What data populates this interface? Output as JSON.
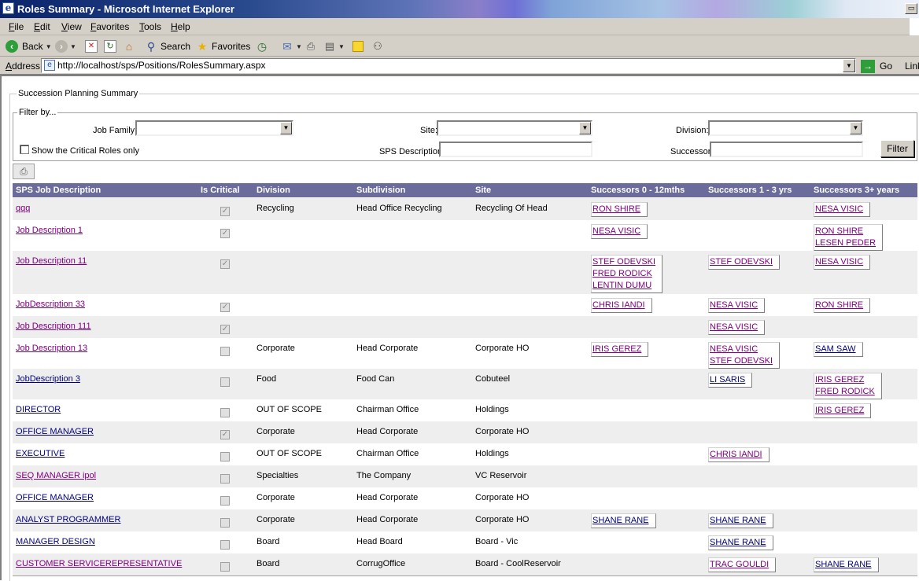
{
  "window": {
    "title": "Roles Summary - Microsoft Internet Explorer",
    "icon": "ie-page-icon"
  },
  "menu": [
    "File",
    "Edit",
    "View",
    "Favorites",
    "Tools",
    "Help"
  ],
  "toolbar": {
    "back_label": "Back",
    "search_label": "Search",
    "favorites_label": "Favorites"
  },
  "address": {
    "label": "Address",
    "url": "http://localhost/sps/Positions/RolesSummary.aspx",
    "go_label": "Go",
    "links_label": "Link"
  },
  "page": {
    "summary_legend": "Succession Planning Summary",
    "filter_legend": "Filter by...",
    "job_family_label": "Job Family:",
    "job_family_value": "",
    "site_label": "Site:",
    "site_value": "",
    "division_label": "Division:",
    "division_value": "",
    "critical_only_label": "Show the Critical Roles only",
    "critical_only_checked": false,
    "sps_description_label": "SPS Description:",
    "sps_description_value": "",
    "successor_label": "Successor:",
    "successor_value": "",
    "filter_button": "Filter"
  },
  "grid": {
    "columns": [
      "SPS Job Description",
      "Is Critical",
      "Division",
      "Subdivision",
      "Site",
      "Successors 0 - 12mths",
      "Successors 1 - 3 yrs",
      "Successors 3+ years"
    ],
    "rows": [
      {
        "job": "qqq",
        "visited": true,
        "critical": true,
        "division": "Recycling",
        "subdivision": "Head Office Recycling",
        "site": "Recycling Of  Head",
        "s0": [
          "RON SHIRE"
        ],
        "s1": [],
        "s3": [
          "NESA VISIC"
        ]
      },
      {
        "job": "Job Description 1",
        "visited": true,
        "critical": true,
        "division": "",
        "subdivision": "",
        "site": "",
        "s0": [
          "NESA VISIC"
        ],
        "s1": [],
        "s3": [
          "RON SHIRE",
          "LESEN PEDER"
        ]
      },
      {
        "job": "Job Description 11",
        "visited": true,
        "critical": true,
        "division": "",
        "subdivision": "",
        "site": "",
        "s0": [
          "STEF ODEVSKI",
          "FRED RODICK",
          "LENTIN DUMU"
        ],
        "s1": [
          "STEF ODEVSKI"
        ],
        "s3": [
          "NESA VISIC"
        ]
      },
      {
        "job": "JobDescription 33",
        "visited": true,
        "critical": true,
        "division": "",
        "subdivision": "",
        "site": "",
        "s0": [
          "CHRIS IANDI"
        ],
        "s1": [
          "NESA VISIC"
        ],
        "s3": [
          "RON SHIRE"
        ]
      },
      {
        "job": "Job Description 111",
        "visited": true,
        "critical": true,
        "division": "",
        "subdivision": "",
        "site": "",
        "s0": [],
        "s1": [
          "NESA VISIC"
        ],
        "s3": []
      },
      {
        "job": "Job Description 13",
        "visited": true,
        "critical": false,
        "division": "Corporate",
        "subdivision": "Head Corporate",
        "site": "Corporate HO",
        "s0": [
          "IRIS GEREZ"
        ],
        "s1": [
          "NESA VISIC",
          "STEF ODEVSKI"
        ],
        "s3": [
          "SAM SAW"
        ]
      },
      {
        "job": "JobDescription 3",
        "visited": false,
        "critical": false,
        "division": "Food",
        "subdivision": "Food Can",
        "site": "Cobuteel",
        "s0": [],
        "s1": [
          "LI SARIS"
        ],
        "s3": [
          "IRIS GEREZ",
          "FRED RODICK"
        ]
      },
      {
        "job": "DIRECTOR",
        "visited": false,
        "critical": false,
        "division": "OUT OF SCOPE",
        "subdivision": "Chairman Office",
        "site": "Holdings",
        "s0": [],
        "s1": [],
        "s3": [
          "IRIS GEREZ"
        ]
      },
      {
        "job": "OFFICE MANAGER",
        "visited": false,
        "critical": true,
        "division": "Corporate",
        "subdivision": "Head Corporate",
        "site": "Corporate HO",
        "s0": [],
        "s1": [],
        "s3": []
      },
      {
        "job": "EXECUTIVE",
        "visited": false,
        "critical": false,
        "division": "OUT OF SCOPE",
        "subdivision": "Chairman Office",
        "site": "Holdings",
        "s0": [],
        "s1": [
          "CHRIS IANDI"
        ],
        "s3": []
      },
      {
        "job": "SEQ MANAGER ipol",
        "visited": true,
        "critical": false,
        "division": "Specialties",
        "subdivision": "The Company",
        "site": "VC Reservoir",
        "s0": [],
        "s1": [],
        "s3": []
      },
      {
        "job": "OFFICE MANAGER",
        "visited": false,
        "critical": false,
        "division": "Corporate",
        "subdivision": "Head Corporate",
        "site": "Corporate HO",
        "s0": [],
        "s1": [],
        "s3": []
      },
      {
        "job": "ANALYST PROGRAMMER",
        "visited": false,
        "critical": false,
        "division": "Corporate",
        "subdivision": "Head Corporate",
        "site": "Corporate HO",
        "s0": [
          "SHANE RANE"
        ],
        "s1": [
          "SHANE RANE"
        ],
        "s3": []
      },
      {
        "job": "MANAGER DESIGN",
        "visited": false,
        "critical": false,
        "division": "Board",
        "subdivision": "Head Board",
        "site": "Board - Vic",
        "s0": [],
        "s1": [
          "SHANE RANE"
        ],
        "s3": []
      },
      {
        "job": "CUSTOMER SERVICEREPRESENTATIVE",
        "visited": true,
        "critical": false,
        "division": "Board",
        "subdivision": "CorrugOffice",
        "site": "Board - CoolReservoir",
        "s0": [],
        "s1": [
          "TRAC GOULDI"
        ],
        "s3": [
          "SHANE RANE"
        ]
      }
    ]
  }
}
